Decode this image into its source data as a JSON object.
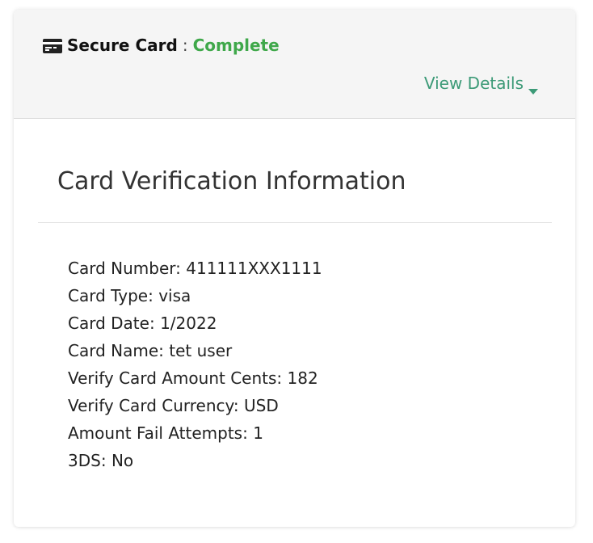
{
  "header": {
    "icon": "credit-card-icon",
    "label": "Secure Card",
    "separator": ":",
    "status": "Complete",
    "status_color": "#3fa84a",
    "view_details_label": "View Details",
    "view_details_icon": "caret-down-icon",
    "link_color": "#3c9a77"
  },
  "section": {
    "title": "Card Verification Information"
  },
  "info": [
    {
      "label": "Card Number",
      "value": "411111XXX1111"
    },
    {
      "label": "Card Type",
      "value": "visa"
    },
    {
      "label": "Card Date",
      "value": "1/2022"
    },
    {
      "label": "Card Name",
      "value": "tet user"
    },
    {
      "label": "Verify Card Amount Cents",
      "value": "182"
    },
    {
      "label": "Verify Card Currency",
      "value": "USD"
    },
    {
      "label": "Amount Fail Attempts",
      "value": "1"
    },
    {
      "label": "3DS",
      "value": "No"
    }
  ]
}
